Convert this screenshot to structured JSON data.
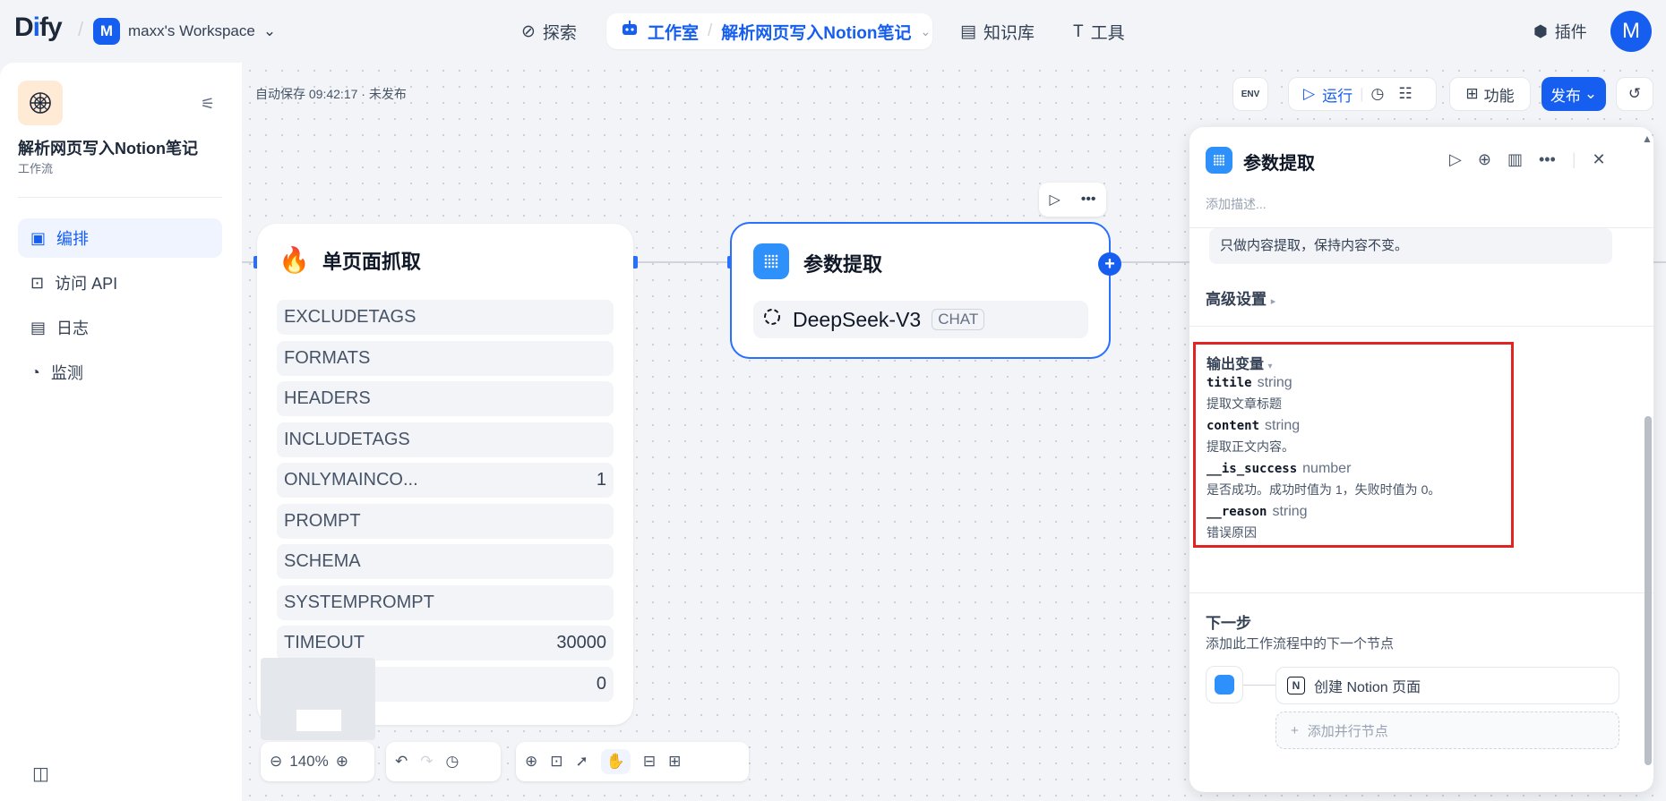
{
  "topbar": {
    "logo": "Dify",
    "workspace_initial": "M",
    "workspace_name": "maxx's Workspace",
    "nav": {
      "explore": "探索",
      "studio": "工作室",
      "current_app": "解析网页写入Notion笔记",
      "knowledge": "知识库",
      "tools": "工具"
    },
    "plugins": "插件",
    "user_initial": "M"
  },
  "sidebar": {
    "app_name": "解析网页写入Notion笔记",
    "app_type": "工作流",
    "items": [
      {
        "label": "编排",
        "active": true
      },
      {
        "label": "访问 API",
        "active": false
      },
      {
        "label": "日志",
        "active": false
      },
      {
        "label": "监测",
        "active": false
      }
    ]
  },
  "canvas": {
    "autosave": "自动保存 09:42:17 · 未发布",
    "toolbar": {
      "env": "ENV",
      "run": "运行",
      "features": "功能",
      "publish": "发布"
    },
    "zoom": "140%"
  },
  "node_scrape": {
    "title": "单页面抓取",
    "params": [
      {
        "name": "EXCLUDETAGS",
        "value": ""
      },
      {
        "name": "FORMATS",
        "value": ""
      },
      {
        "name": "HEADERS",
        "value": ""
      },
      {
        "name": "INCLUDETAGS",
        "value": ""
      },
      {
        "name": "ONLYMAINCO...",
        "value": "1"
      },
      {
        "name": "PROMPT",
        "value": ""
      },
      {
        "name": "SCHEMA",
        "value": ""
      },
      {
        "name": "SYSTEMPROMPT",
        "value": ""
      },
      {
        "name": "TIMEOUT",
        "value": "30000"
      },
      {
        "name": "",
        "value": "0"
      }
    ]
  },
  "node_param": {
    "title": "参数提取",
    "model": "DeepSeek-V3",
    "badge": "CHAT"
  },
  "panel": {
    "title": "参数提取",
    "desc_placeholder": "添加描述...",
    "instruction": "只做内容提取，保持内容不变。",
    "advanced": "高级设置",
    "output_title": "输出变量",
    "outputs": [
      {
        "name": "titile",
        "type": "string",
        "desc": "提取文章标题"
      },
      {
        "name": "content",
        "type": "string",
        "desc": "提取正文内容。"
      },
      {
        "name": "__is_success",
        "type": "number",
        "desc": "是否成功。成功时值为 1，失败时值为 0。"
      },
      {
        "name": "__reason",
        "type": "string",
        "desc": "错误原因"
      }
    ],
    "next_title": "下一步",
    "next_sub": "添加此工作流程中的下一个节点",
    "next_node": "创建 Notion 页面",
    "add_parallel": "添加并行节点"
  }
}
